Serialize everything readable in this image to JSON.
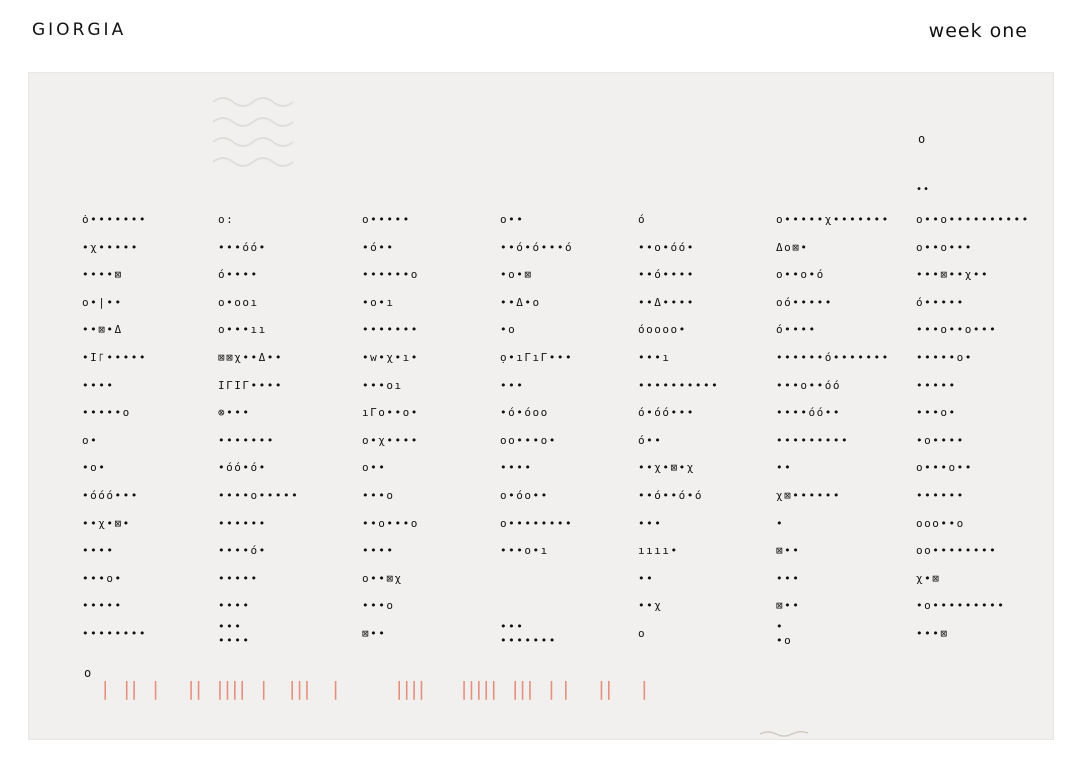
{
  "header": {
    "name": "GIORGIA",
    "week": "week one"
  },
  "card": {
    "corner_o": "o",
    "top_dots": "••",
    "bottom_o": "o",
    "tally": "|  ||  |    ||  ||||  |   |||   |        ||||     |||||  |||  | |    ||    |"
  },
  "columns": [
    {
      "rows": [
        "ȯ•••••••",
        "•χ•••••",
        "••••⊠",
        "o•|••",
        "••⊠•Δ",
        "•Ι꜒•••••",
        "••••",
        "•••••o",
        "o•",
        "•o•",
        "•óóó•••",
        "••χ•⊠•",
        "••••",
        "•••o•",
        "•••••",
        "••••••••"
      ]
    },
    {
      "rows": [
        "o:",
        "•••óó•",
        "ó••••",
        "o•ooı",
        "o•••ıı",
        "⊠⊠χ••Δ••",
        "ΙΓΙΓ••••",
        "⊗•••",
        "•••••••",
        "•óó•ó•",
        "••••o•••••",
        "••••••",
        "••••ó•",
        "•••••",
        "••••",
        "•••\n••••"
      ]
    },
    {
      "rows": [
        "o•••••",
        "•ó••",
        "••••••o",
        "•o•ı",
        "•••••••",
        "•w•χ•ı•",
        "•••oı",
        "ıΓo••o•",
        "o•χ••••",
        "o••",
        "•••o",
        "••o•••o",
        "••••",
        "o••⊠χ",
        "•••o",
        "⊠••"
      ]
    },
    {
      "rows": [
        "o••",
        "••ó•ó•••ó",
        "•o•⊠",
        "••Δ•o",
        "•o",
        "ọ•ıΓıΓ•••",
        "•••",
        "•ó•óoo",
        "oo•••o•",
        "••••",
        "o•óo••",
        "o••••••••",
        "•••o•ı",
        "",
        "",
        "•••\n•••••••"
      ]
    },
    {
      "rows": [
        "ó",
        "••o•óó•",
        "••ó••••",
        "••Δ••••",
        "óoooo•",
        "•••ı",
        "••••••••••",
        "ó•óó•••",
        "ó••",
        "••χ•⊠•χ",
        "••ó••ó•ó",
        "•••",
        "ıııı•",
        "••",
        "••χ",
        "o"
      ]
    },
    {
      "rows": [
        "o•••••χ•••••••",
        "Δo⊠•",
        "o••o•ó",
        "oó•••••",
        "ó••••",
        "••••••ó•••••••",
        "•••o••óó",
        "••••óó••",
        "•••••••••",
        "••",
        "χ⊠••••••",
        "•",
        "⊠••",
        "•••",
        "⊠••",
        "•\n•o"
      ]
    },
    {
      "rows": [
        "o••o••••••••••",
        "o••o•••",
        "•••⊠••χ••",
        "ó•••••",
        "•••o••o•••",
        "•••••o•",
        "•••••",
        "•••o•",
        "•o••••",
        "o•••o••",
        "••••••",
        "ooo••o",
        "oo••••••••",
        "χ•⊠",
        "•o•••••••••",
        "•••⊠"
      ]
    }
  ]
}
